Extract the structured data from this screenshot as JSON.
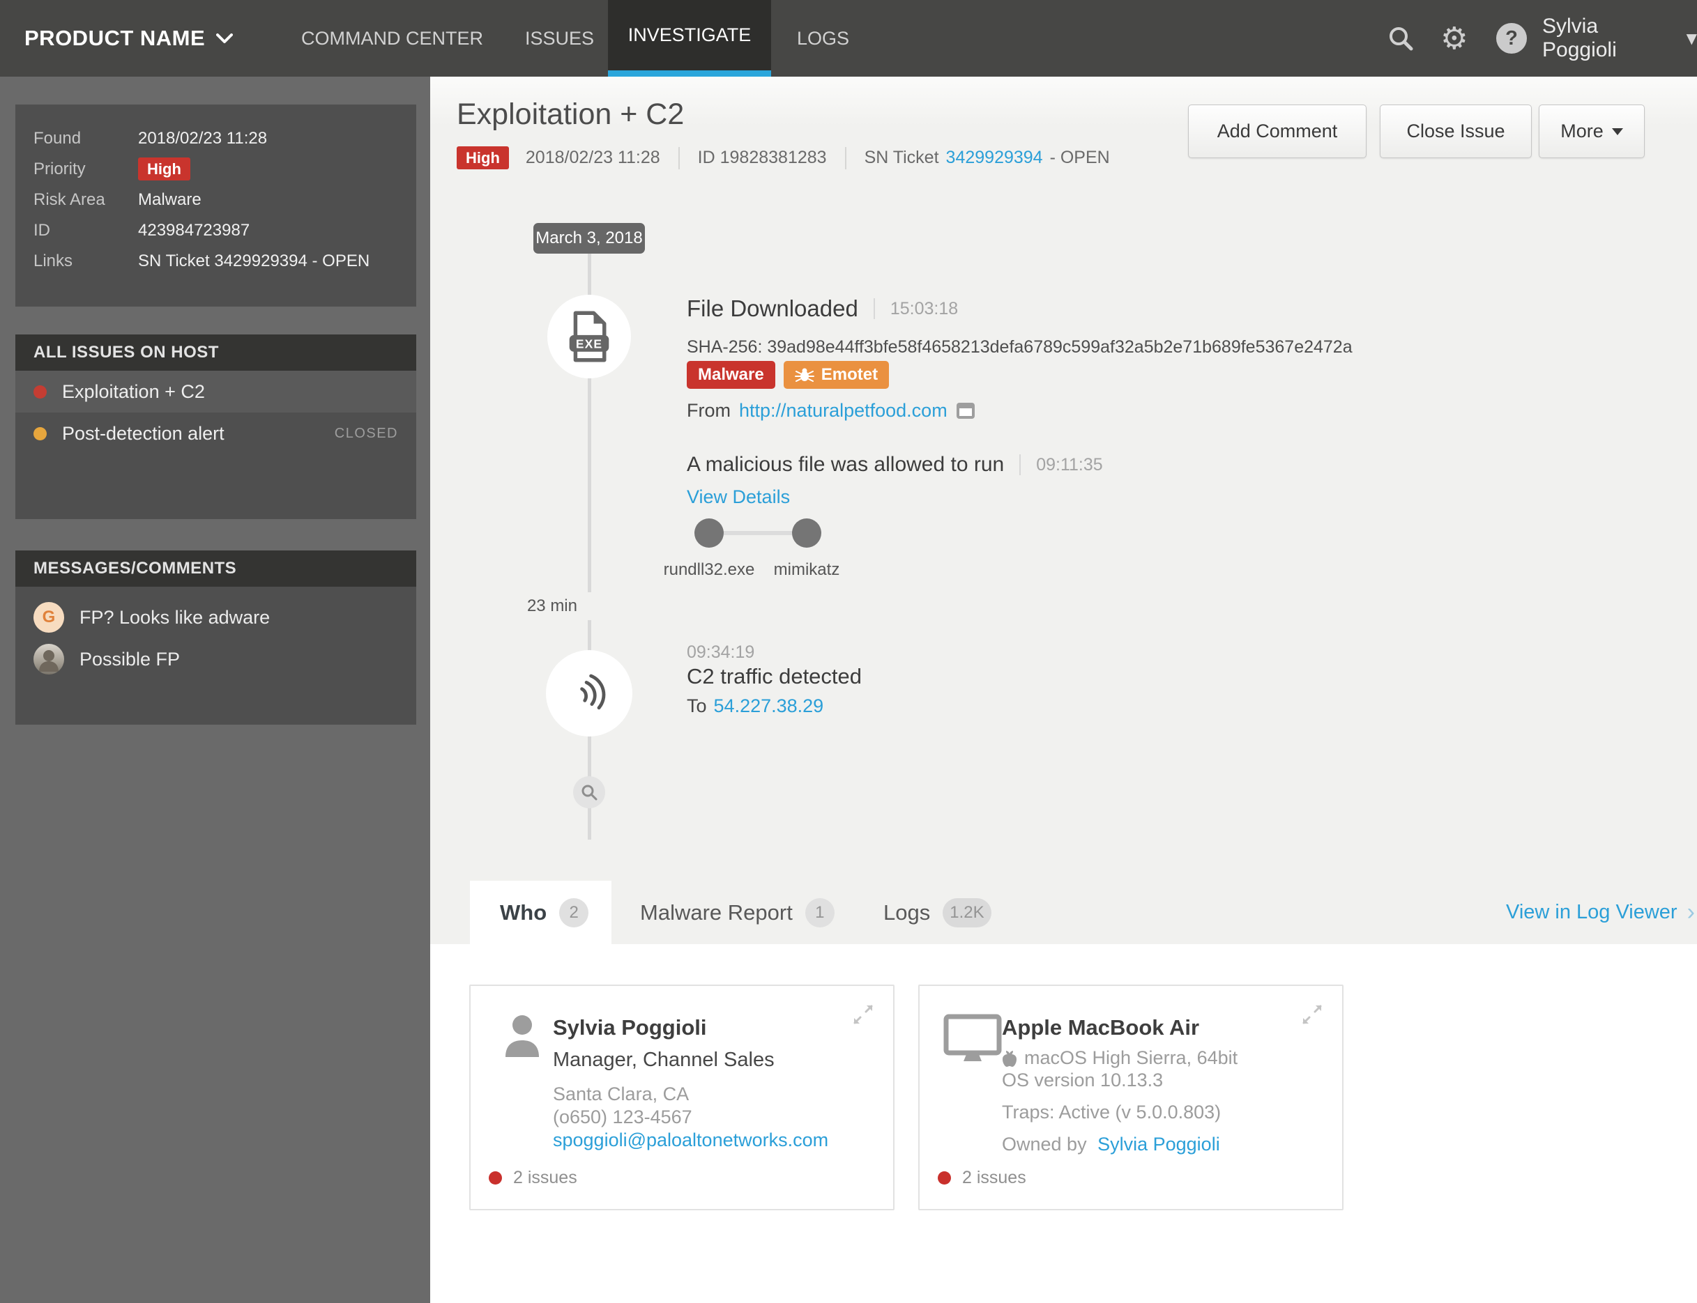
{
  "nav": {
    "product": "PRODUCT NAME",
    "items": [
      {
        "label": "COMMAND CENTER",
        "active": false
      },
      {
        "label": "ISSUES",
        "active": false
      },
      {
        "label": "INVESTIGATE",
        "active": true
      },
      {
        "label": "LOGS",
        "active": false
      }
    ],
    "user": "Sylvia Poggioli"
  },
  "sidebar": {
    "details": {
      "rows": [
        {
          "label": "Found",
          "value": "2018/02/23 11:28"
        },
        {
          "label": "Priority",
          "value": "High"
        },
        {
          "label": "Risk Area",
          "value": "Malware"
        },
        {
          "label": "ID",
          "value": "423984723987"
        },
        {
          "label": "Links",
          "value": "SN Ticket 3429929394 - OPEN"
        }
      ]
    },
    "issues": {
      "title": "ALL ISSUES ON HOST",
      "rows": [
        {
          "label": "Exploitation + C2",
          "status": "",
          "selected": true
        },
        {
          "label": "Post-detection alert",
          "status": "CLOSED",
          "selected": false
        }
      ]
    },
    "messages": {
      "title": "MESSAGES/COMMENTS",
      "rows": [
        {
          "avatar": "G",
          "text": "FP? Looks like adware"
        },
        {
          "avatar": "photo",
          "text": "Possible FP"
        }
      ]
    }
  },
  "main": {
    "title": "Exploitation + C2",
    "meta": {
      "priority": "High",
      "date": "2018/02/23 11:28",
      "id": "ID 19828381283",
      "ticket_label": "SN Ticket",
      "ticket_link": "3429929394",
      "ticket_status": "- OPEN"
    },
    "buttons": {
      "add_comment": "Add Comment",
      "close_issue": "Close Issue",
      "more": "More"
    },
    "timeline": {
      "date_badge": "March 3, 2018",
      "gap": "23 min",
      "ev1": {
        "title": "File Downloaded",
        "time": "15:03:18",
        "sha": "SHA-256: 39ad98e44ff3bfe58f4658213defa6789c599af32a5b2e71b689fe5367e2472a",
        "badge_malware": "Malware",
        "badge_emotet": "Emotet",
        "from_label": "From",
        "from_link": "http://naturalpetfood.com"
      },
      "ev2": {
        "title": "A malicious file was allowed to run",
        "time": "09:11:35",
        "link": "View Details",
        "node1": "rundll32.exe",
        "node2": "mimikatz"
      },
      "ev3": {
        "time": "09:34:19",
        "title": "C2 traffic detected",
        "to_label": "To",
        "to_link": "54.227.38.29"
      }
    },
    "tabs": [
      {
        "label": "Who",
        "count": "2",
        "active": true
      },
      {
        "label": "Malware Report",
        "count": "1",
        "active": false
      },
      {
        "label": "Logs",
        "count": "1.2K",
        "active": false
      }
    ],
    "log_viewer_link": "View in Log Viewer",
    "cards": [
      {
        "name": "Sylvia Poggioli",
        "subtitle": "Manager, Channel Sales",
        "location": "Santa Clara, CA",
        "phone": "(o650) 123-4567",
        "email": "spoggioli@paloaltonetworks.com",
        "issues": "2 issues"
      },
      {
        "name": "Apple MacBook Air",
        "os": "macOS High Sierra, 64bit",
        "os_version": "OS version 10.13.3",
        "traps": "Traps: Active (v 5.0.0.803)",
        "owned_label": "Owned by",
        "owner": "Sylvia Poggioli",
        "issues": "2 issues"
      }
    ]
  },
  "icons": {
    "chevron-down-icon": "▾",
    "chevron-right-icon": "›",
    "gear-icon": "⚙",
    "help-icon": "?",
    "search-icon": "magnifier-svg",
    "exe-file-icon": "svg",
    "signal-icon": "svg",
    "zoom-icon": "svg",
    "bug-icon": "svg",
    "open-link-icon": "svg",
    "person-icon": "svg",
    "monitor-icon": "svg",
    "apple-icon": "svg",
    "expand-icon": "svg"
  },
  "colors": {
    "accent_blue": "#2b9fd8",
    "priority_red": "#c9342d",
    "emotet_orange": "#ea9140",
    "warning_yellow": "#e7a63d",
    "issue_dot_red": "#c9302c",
    "investigate_underline": "#2aa6db",
    "nav_bg": "#474745",
    "sidebar_bg": "#6a6a6a",
    "panel_bg": "#4f4f4f"
  }
}
